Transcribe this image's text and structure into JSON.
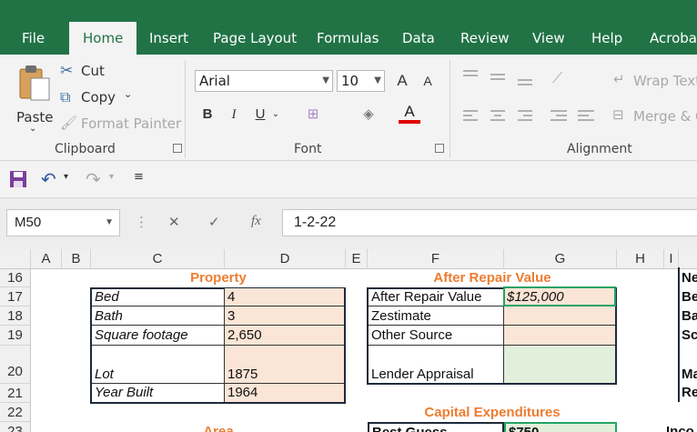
{
  "ribbon_tabs": [
    "File",
    "Home",
    "Insert",
    "Page Layout",
    "Formulas",
    "Data",
    "Review",
    "View",
    "Help",
    "Acrobat"
  ],
  "active_tab": "Home",
  "clipboard": {
    "paste": "Paste",
    "cut": "Cut",
    "copy": "Copy",
    "format_painter": "Format Painter",
    "group": "Clipboard"
  },
  "font": {
    "name": "Arial",
    "size": "10",
    "bold": "B",
    "italic": "I",
    "underline": "U",
    "group": "Font",
    "grow": "A",
    "shrink": "A",
    "color_a": "A"
  },
  "alignment": {
    "wrap_text": "Wrap Text",
    "merge": "Merge & C",
    "group": "Alignment"
  },
  "name_box": "M50",
  "formula_bar": {
    "cancel": "✕",
    "enter": "✓",
    "fx": "fx",
    "value": "1-2-22"
  },
  "columns": [
    "A",
    "B",
    "C",
    "D",
    "E",
    "F",
    "G",
    "H",
    "I"
  ],
  "rows": [
    "16",
    "17",
    "18",
    "19",
    "20",
    "21",
    "22",
    "23"
  ],
  "property": {
    "title": "Property",
    "rows": [
      {
        "label": "Bed",
        "value": "4"
      },
      {
        "label": "Bath",
        "value": "3"
      },
      {
        "label": "Square footage",
        "value": "2,650"
      },
      {
        "label": "Lot",
        "value": "1875"
      },
      {
        "label": "Year Built",
        "value": "1964"
      }
    ]
  },
  "arv": {
    "title": "After Repair Value",
    "rows": [
      {
        "label": "After Repair Value",
        "value": "$125,000"
      },
      {
        "label": "Zestimate",
        "value": ""
      },
      {
        "label": "Other Source",
        "value": ""
      },
      {
        "label": "Lender Appraisal",
        "value": ""
      }
    ]
  },
  "capex": {
    "title": "Capital Expenditures",
    "best_guess_label": "Best Guess",
    "best_guess_value": "$750"
  },
  "area_title": "Area",
  "col_i_fragments": [
    "Ne",
    "Be",
    "Ba",
    "Sc",
    "Ma",
    "Re",
    "Inco"
  ],
  "colors": {
    "excel_green": "#217346",
    "accent_orange": "#ed7d31",
    "peach": "#fbe5d6",
    "light_green": "#e2efda",
    "selection": "#21a366"
  }
}
